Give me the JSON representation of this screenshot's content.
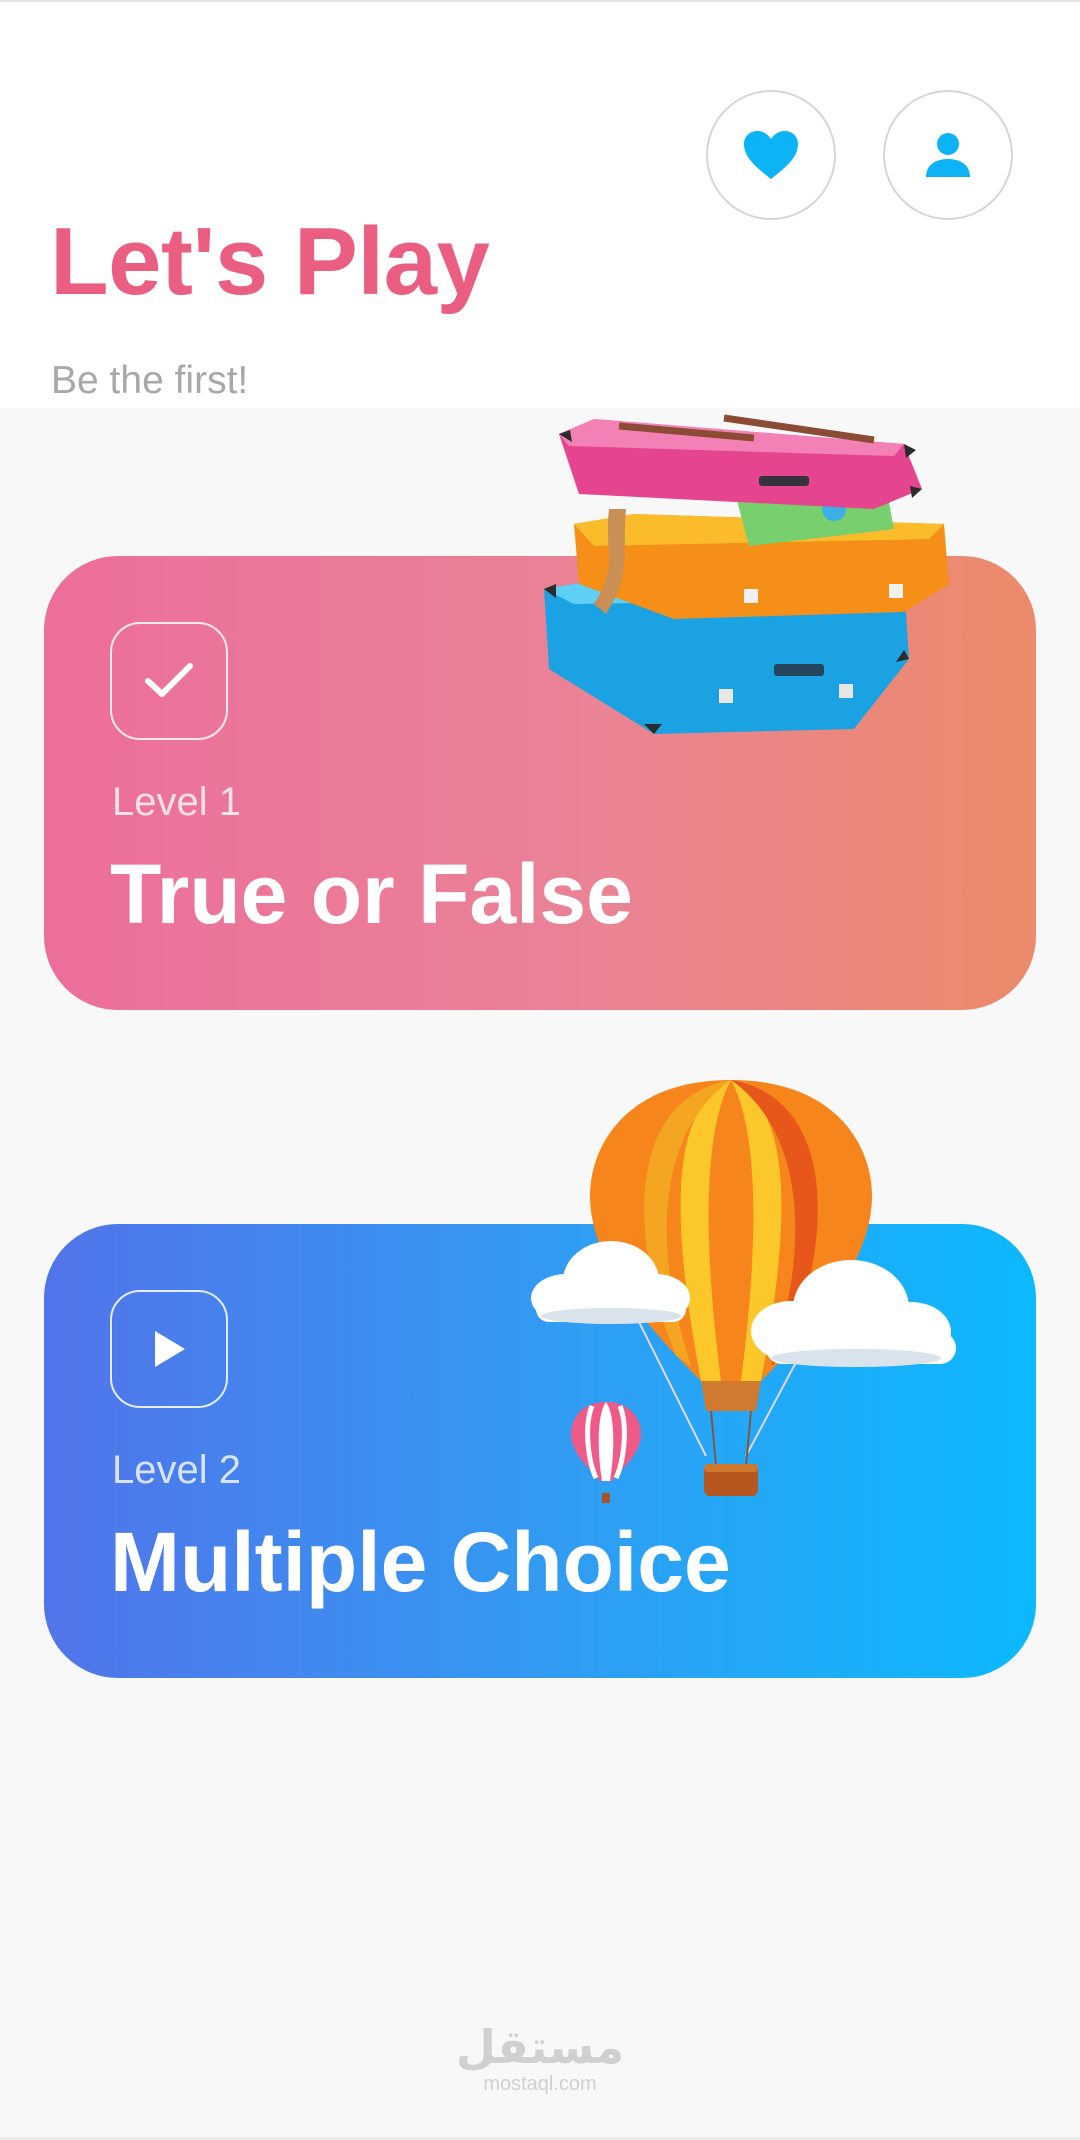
{
  "header": {
    "title": "Let's Play",
    "subtitle": "Be the first!",
    "favorites_icon": "heart-icon",
    "profile_icon": "user-icon",
    "accent_color": "#ea5f81",
    "icon_color": "#0cb3f5"
  },
  "levels": [
    {
      "level_label": "Level 1",
      "name": "True or False",
      "icon": "check-icon",
      "illustration": "stacked-suitcases",
      "gradient": [
        "#ec6e9b",
        "#ec8b6a"
      ]
    },
    {
      "level_label": "Level 2",
      "name": "Multiple Choice",
      "icon": "play-icon",
      "illustration": "hot-air-balloons",
      "gradient": [
        "#5274ea",
        "#0cb9fe"
      ]
    }
  ],
  "watermark": {
    "arabic": "مستقل",
    "latin": "mostaql.com"
  }
}
